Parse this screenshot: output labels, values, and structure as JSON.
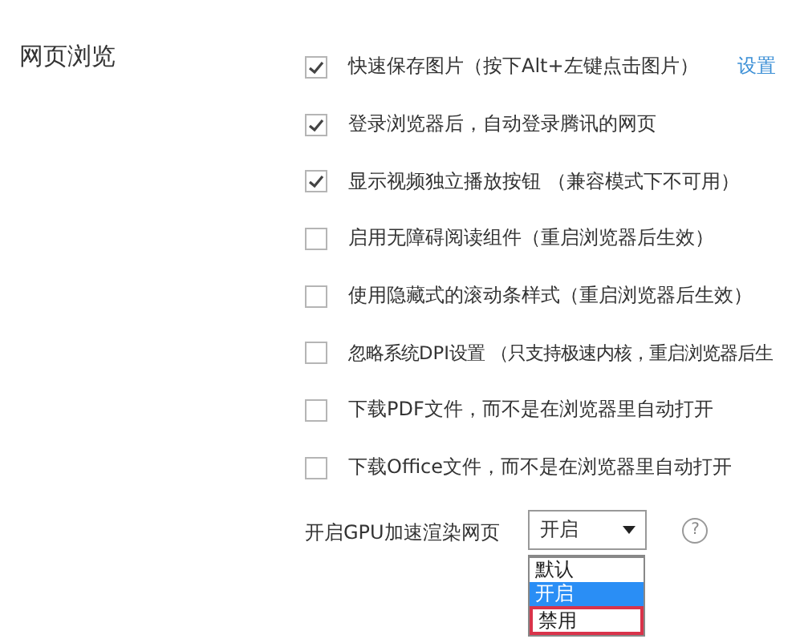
{
  "section": {
    "title": "网页浏览"
  },
  "options": [
    {
      "label": "快速保存图片（按下Alt+左键点击图片）",
      "checked": true,
      "link": "设置"
    },
    {
      "label": "登录浏览器后，自动登录腾讯的网页",
      "checked": true
    },
    {
      "label": "显示视频独立播放按钮 （兼容模式下不可用）",
      "checked": true
    },
    {
      "label": "启用无障碍阅读组件（重启浏览器后生效）",
      "checked": false
    },
    {
      "label": "使用隐藏式的滚动条样式（重启浏览器后生效）",
      "checked": false
    },
    {
      "label": "忽略系统DPI设置 （只支持极速内核，重启浏览器后生",
      "checked": false
    },
    {
      "label": "下载PDF文件，而不是在浏览器里自动打开",
      "checked": false
    },
    {
      "label": "下载Office文件，而不是在浏览器里自动打开",
      "checked": false
    }
  ],
  "gpu": {
    "label": "开启GPU加速渲染网页",
    "value": "开启",
    "expanded": true,
    "help": "?",
    "items": [
      {
        "label": "默认",
        "selected": false,
        "outlined": false
      },
      {
        "label": "开启",
        "selected": true,
        "outlined": false
      },
      {
        "label": "禁用",
        "selected": false,
        "outlined": true
      }
    ]
  }
}
